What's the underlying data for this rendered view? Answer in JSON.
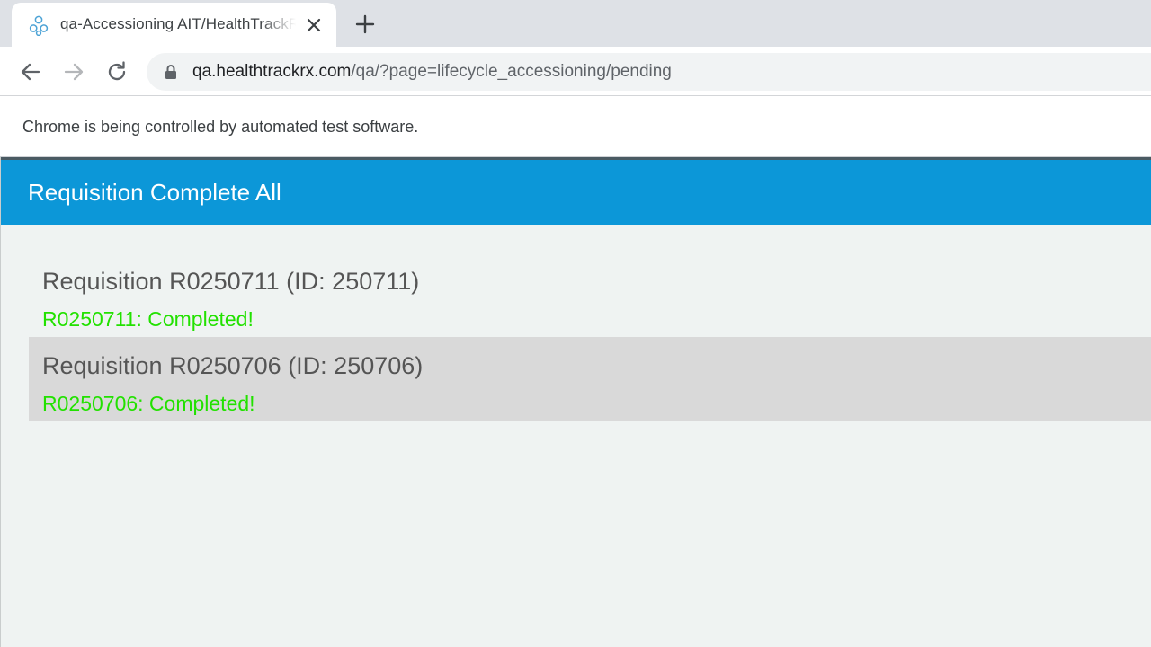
{
  "browser": {
    "tab": {
      "title": "qa-Accessioning AIT/HealthTrackRx",
      "favicon": "healthtrackrx-logo-icon",
      "close_icon": "close-icon"
    },
    "new_tab_icon": "plus-icon",
    "nav": {
      "back_icon": "arrow-left-icon",
      "forward_icon": "arrow-right-icon",
      "reload_icon": "reload-icon"
    },
    "address_bar": {
      "lock_icon": "lock-icon",
      "host": "qa.healthtrackrx.com",
      "path": "/qa/?page=lifecycle_accessioning/pending"
    },
    "infobar_text": "Chrome is being controlled by automated test software."
  },
  "page": {
    "header_title": "Requisition Complete All",
    "header_color": "#0c97d8",
    "requisitions": [
      {
        "heading": "Requisition R0250711 (ID: 250711)",
        "status": "R0250711: Completed!"
      },
      {
        "heading": "Requisition R0250706 (ID: 250706)",
        "status": "R0250706: Completed!"
      }
    ],
    "status_color": "#22e100"
  }
}
